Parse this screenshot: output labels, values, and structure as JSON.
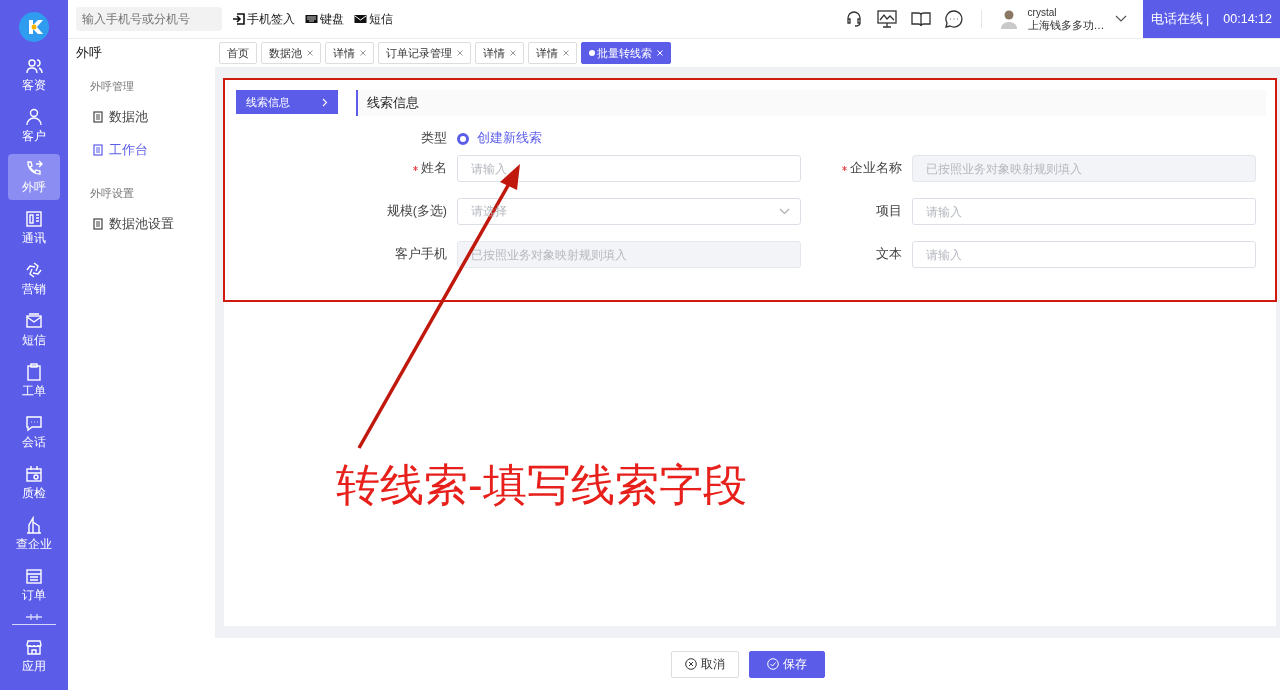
{
  "topbar": {
    "search": {
      "placeholder": "输入手机号或分机号"
    },
    "actions": [
      {
        "label": "手机签入"
      },
      {
        "label": "键盘"
      },
      {
        "label": "短信"
      }
    ],
    "user": {
      "name": "crystal",
      "company": "上海钱多多功…"
    },
    "call_status": {
      "status": "电话在线 |",
      "timer": "00:14:12"
    }
  },
  "rail": [
    {
      "label": "客资",
      "selected": false
    },
    {
      "label": "客户",
      "selected": false
    },
    {
      "label": "外呼",
      "selected": true
    },
    {
      "label": "通讯",
      "selected": false
    },
    {
      "label": "营销",
      "selected": false
    },
    {
      "label": "短信",
      "selected": false
    },
    {
      "label": "工单",
      "selected": false
    },
    {
      "label": "会话",
      "selected": false
    },
    {
      "label": "质检",
      "selected": false
    },
    {
      "label": "查企业",
      "selected": false
    },
    {
      "label": "订单",
      "selected": false
    },
    {
      "label": "应用",
      "selected": false
    }
  ],
  "submenu": {
    "title": "外呼",
    "groups": [
      {
        "title": "外呼管理",
        "items": [
          {
            "label": "数据池",
            "selected": false
          },
          {
            "label": "工作台",
            "selected": true
          }
        ]
      },
      {
        "title": "外呼设置",
        "items": [
          {
            "label": "数据池设置",
            "selected": false
          }
        ]
      }
    ]
  },
  "tabs": [
    {
      "label": "首页",
      "closable": false,
      "selected": false
    },
    {
      "label": "数据池",
      "closable": true,
      "selected": false
    },
    {
      "label": "详情",
      "closable": true,
      "selected": false
    },
    {
      "label": "订单记录管理",
      "closable": true,
      "selected": false
    },
    {
      "label": "详情",
      "closable": true,
      "selected": false
    },
    {
      "label": "详情",
      "closable": true,
      "selected": false
    },
    {
      "label": "批量转线索",
      "closable": true,
      "selected": true
    }
  ],
  "form": {
    "steps": [
      {
        "label": "线索信息",
        "selected": true
      }
    ],
    "section_title": "线索信息",
    "type": {
      "label": "类型",
      "option": "创建新线索",
      "selected": true
    },
    "fields": [
      {
        "label": "姓名",
        "required": true,
        "kind": "input",
        "placeholder": "请输入",
        "disabled": false
      },
      {
        "label": "企业名称",
        "required": true,
        "kind": "input",
        "placeholder": "已按照业务对象映射规则填入",
        "disabled": true
      },
      {
        "label": "规模(多选)",
        "required": false,
        "kind": "select",
        "placeholder": "请选择",
        "disabled": false
      },
      {
        "label": "项目",
        "required": false,
        "kind": "input",
        "placeholder": "请输入",
        "disabled": false
      },
      {
        "label": "客户手机",
        "required": false,
        "kind": "input",
        "placeholder": "已按照业务对象映射规则填入",
        "disabled": true
      },
      {
        "label": "文本",
        "required": false,
        "kind": "input",
        "placeholder": "请输入",
        "disabled": false
      }
    ]
  },
  "buttons": [
    {
      "label": "取消",
      "kind": "secondary"
    },
    {
      "label": "保存",
      "kind": "primary"
    }
  ],
  "annotation": {
    "text": "转线索-填写线索字段"
  }
}
